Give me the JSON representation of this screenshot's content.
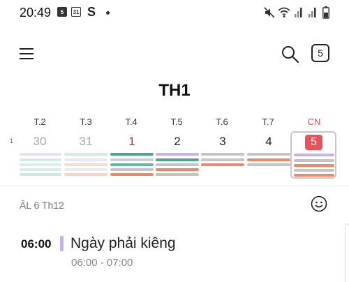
{
  "status_bar": {
    "time": "20:49",
    "calendar_badge": "5",
    "calendar_badge_2": "31",
    "s_icon": "S",
    "icons": [
      "mute-icon",
      "wifi-icon",
      "signal-icon",
      "signal-icon",
      "battery-icon"
    ]
  },
  "header": {
    "today_label": "5",
    "month_title": "TH1"
  },
  "week": {
    "week_number": "1",
    "days": [
      {
        "dow": "T.2",
        "date": "30",
        "style": "gray"
      },
      {
        "dow": "T.3",
        "date": "31",
        "style": "gray"
      },
      {
        "dow": "T.4",
        "date": "1",
        "style": "red"
      },
      {
        "dow": "T.5",
        "date": "2",
        "style": "dark"
      },
      {
        "dow": "T.6",
        "date": "3",
        "style": "dark"
      },
      {
        "dow": "T.7",
        "date": "4",
        "style": "dark"
      },
      {
        "dow": "CN",
        "date": "5",
        "style": "selected"
      }
    ]
  },
  "agenda": {
    "lunar_date": "ÂL 6 Th12",
    "event": {
      "start": "06:00",
      "title": "Ngày phải kiêng",
      "range": "06:00 - 07:00",
      "color": "#c6b2e3"
    }
  },
  "colors": {
    "sunday": "#e24b4b",
    "selected_badge": "#e8535b",
    "holiday_red": "#c52a2a",
    "green": "#4fa58e",
    "orange": "#ea8a6c",
    "purple": "#c6b2e3",
    "gray": "#c4c4c4"
  }
}
